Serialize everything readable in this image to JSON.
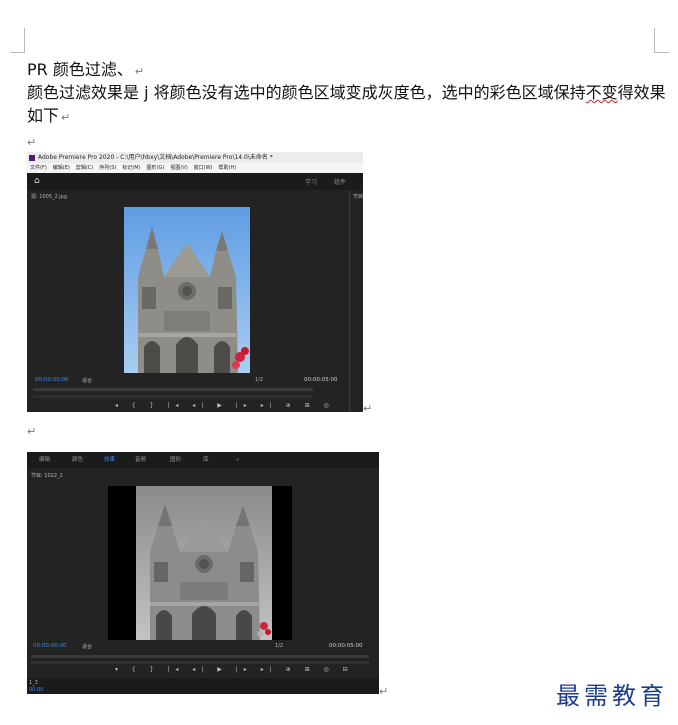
{
  "document": {
    "heading": "PR 颜色过滤、",
    "body_line1_a": "颜色过滤效果是 j 将颜色没有选中的颜色区域变成灰度色，选中的彩色区域保持",
    "body_line1_squiggle": "不变",
    "body_line1_b": "得效果",
    "body_line2": "如下",
    "paragraph_mark": "↵"
  },
  "screenshot1": {
    "title": "Adobe Premiere Pro 2020 - C:\\用户\\hbxy\\文档\\Adobe\\Premiere Pro\\14.0\\未命名 *",
    "menu": [
      "文件(F)",
      "编辑(E)",
      "剪辑(C)",
      "序列(S)",
      "标记(M)",
      "图形(G)",
      "视图(V)",
      "窗口(W)",
      "帮助(H)"
    ],
    "workspaces": [
      "学习",
      "组件"
    ],
    "source_panel": "源: 1005_2.jpg",
    "right_panel": "节目",
    "timecode_left": "00:00:00:00",
    "fit": "适合",
    "resolution": "1/2",
    "timecode_right": "00:00:05:00"
  },
  "screenshot2": {
    "tabs": [
      "编辑",
      "颜色",
      "效果",
      "音频",
      "图形",
      "库"
    ],
    "active_tab": "效果",
    "program_panel": "节目: 1022_2",
    "timecode_left": "00:00:00:00",
    "fit": "适合",
    "resolution": "1/2",
    "timecode_right": "00:00:05:00",
    "bottom_label": "1_3",
    "bottom_timecode": "00:00"
  },
  "watermark": "最需教育",
  "colors": {
    "panel_bg": "#232323",
    "accent_blue": "#3b8ce8",
    "watermark": "#1e3d8f",
    "spellcheck": "#d12a2a"
  }
}
